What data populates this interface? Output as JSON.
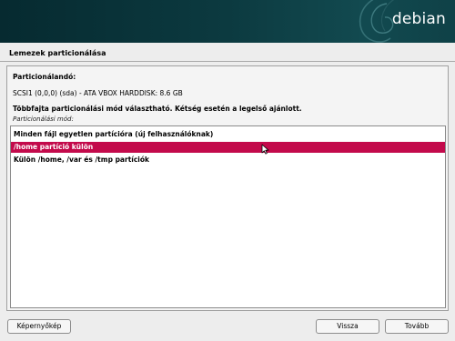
{
  "header": {
    "brand": "debian"
  },
  "window": {
    "title": "Lemezek particionálása"
  },
  "main": {
    "question": "Particionálandó:",
    "disk": "SCSI1 (0,0,0) (sda) - ATA VBOX HARDDISK: 8.6 GB",
    "hint": "Többfajta particionálási mód választható. Kétség esetén a legelső ajánlott.",
    "list_caption": "Particionálási mód:",
    "options": [
      {
        "label": "Minden fájl egyetlen partícióra (új felhasználóknak)",
        "selected": false
      },
      {
        "label": "/home partíció külön",
        "selected": true
      },
      {
        "label": "Külön /home, /var és /tmp partíciók",
        "selected": false
      }
    ]
  },
  "footer": {
    "screenshot_label": "Képernyőkép",
    "back_label": "Vissza",
    "next_label": "Tovább"
  },
  "colors": {
    "banner": "#0c3a40",
    "selection": "#c30a4b",
    "background": "#ededed"
  },
  "icons": {
    "cursor": "mouse-pointer-icon",
    "swirl": "debian-swirl-icon"
  }
}
